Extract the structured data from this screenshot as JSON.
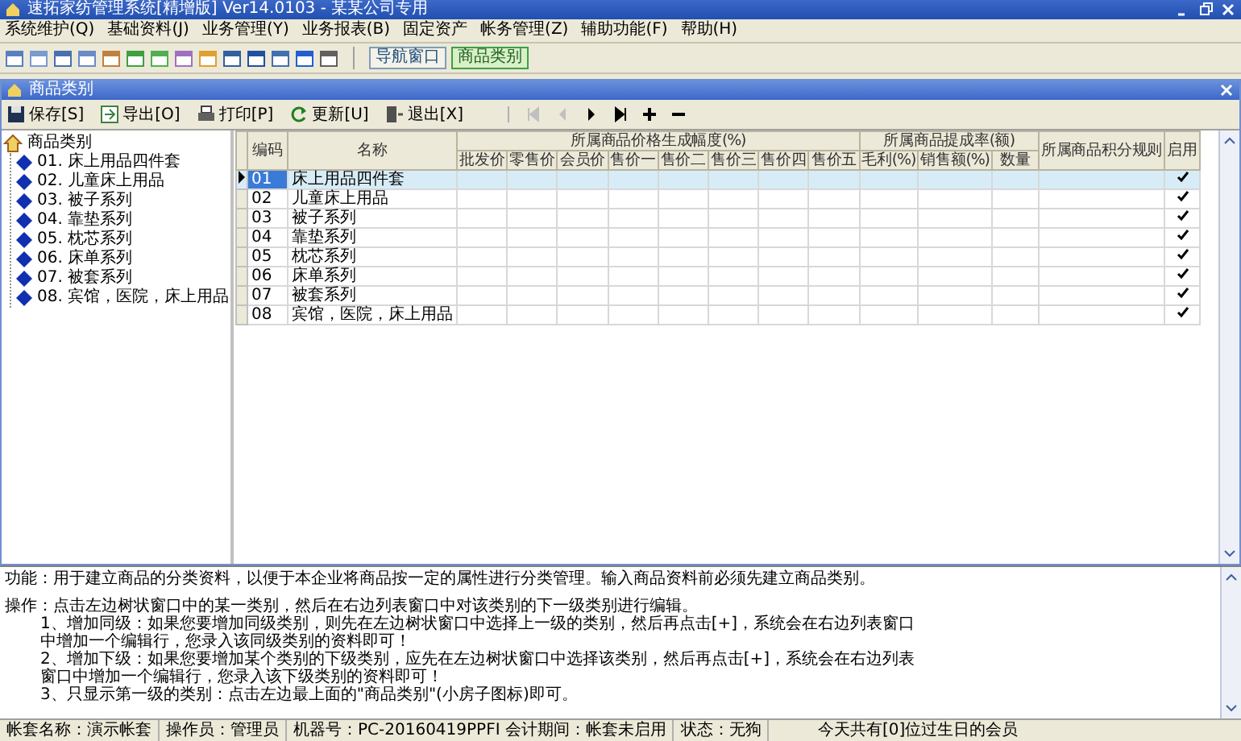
{
  "window": {
    "title": "速拓家纺管理系统[精增版] Ver14.0103 - 某某公司专用"
  },
  "menu": [
    "系统维护(Q)",
    "基础资料(J)",
    "业务管理(Y)",
    "业务报表(B)",
    "固定资产",
    "帐务管理(Z)",
    "辅助功能(F)",
    "帮助(H)"
  ],
  "toolbar": {
    "buttons": [
      {
        "label": "导航窗口",
        "selected": false
      },
      {
        "label": "商品类别",
        "selected": true
      }
    ]
  },
  "child_window": {
    "title": "商品类别"
  },
  "child_toolbar": {
    "buttons": [
      {
        "label": "保存[S]",
        "kind": "save"
      },
      {
        "label": "导出[O]",
        "kind": "export"
      },
      {
        "label": "打印[P]",
        "kind": "print"
      },
      {
        "label": "更新[U]",
        "kind": "refresh"
      },
      {
        "label": "退出[X]",
        "kind": "exit"
      }
    ],
    "nav": [
      {
        "kind": "first",
        "disabled": true
      },
      {
        "kind": "prev",
        "disabled": true
      },
      {
        "kind": "next",
        "disabled": false
      },
      {
        "kind": "last",
        "disabled": false
      },
      {
        "kind": "add",
        "disabled": false
      },
      {
        "kind": "remove",
        "disabled": false
      }
    ]
  },
  "tree": {
    "root": "商品类别",
    "children": [
      {
        "label": "01. 床上用品四件套"
      },
      {
        "label": "02. 儿童床上用品"
      },
      {
        "label": "03. 被子系列"
      },
      {
        "label": "04. 靠垫系列"
      },
      {
        "label": "05. 枕芯系列"
      },
      {
        "label": "06. 床单系列"
      },
      {
        "label": "07. 被套系列"
      },
      {
        "label": "08. 宾馆，医院，床上用品"
      }
    ]
  },
  "grid": {
    "columns": [
      "编码",
      "名称"
    ],
    "groups": [
      {
        "label": "所属商品价格生成幅度(%)",
        "columns": [
          "批发价",
          "零售价",
          "会员价",
          "售价一",
          "售价二",
          "售价三",
          "售价四",
          "售价五"
        ]
      },
      {
        "label": "所属商品提成率(额)",
        "columns": [
          "毛利(%)",
          "销售额(%)",
          "数量"
        ]
      }
    ],
    "tail_columns": [
      "所属商品积分规则",
      "启用"
    ],
    "rows": [
      {
        "code": "01",
        "name": "床上用品四件套",
        "selected": true,
        "enabled": true
      },
      {
        "code": "02",
        "name": "儿童床上用品",
        "selected": false,
        "enabled": true
      },
      {
        "code": "03",
        "name": "被子系列",
        "selected": false,
        "enabled": true
      },
      {
        "code": "04",
        "name": "靠垫系列",
        "selected": false,
        "enabled": true
      },
      {
        "code": "05",
        "name": "枕芯系列",
        "selected": false,
        "enabled": true
      },
      {
        "code": "06",
        "name": "床单系列",
        "selected": false,
        "enabled": true
      },
      {
        "code": "07",
        "name": "被套系列",
        "selected": false,
        "enabled": true
      },
      {
        "code": "08",
        "name": "宾馆，医院，床上用品",
        "selected": false,
        "enabled": true
      }
    ]
  },
  "help": {
    "lines": [
      {
        "text": "功能：用于建立商品的分类资料，以便于本企业将商品按一定的属性进行分类管理。输入商品资料前必须先建立商品类别。",
        "indent": false
      },
      {
        "text": "操作：点击左边树状窗口中的某一类别，然后在右边列表窗口中对该类别的下一级类别进行编辑。",
        "indent": false
      },
      {
        "text": "1、增加同级：如果您要增加同级类别，则先在左边树状窗口中选择上一级的类别，然后再点击[+]，系统会在右边列表窗口中增加一个编辑行，您录入该同级类别的资料即可！",
        "indent": true
      },
      {
        "text": "2、增加下级：如果您要增加某个类别的下级类别，应先在左边树状窗口中选择该类别，然后再点击[+]，系统会在右边列表窗口中增加一个编辑行，您录入该下级类别的资料即可！",
        "indent": true
      },
      {
        "text": "3、只显示第一级的类别：点击左边最上面的\"商品类别\"(小房子图标)即可。",
        "indent": true
      }
    ]
  },
  "status_bar": [
    "帐套名称：演示帐套",
    "操作员：管理员",
    "机器号：PC-20160419PPFI 会计期间：帐套未启用",
    "状态：无狗",
    "今天共有[0]位过生日的会员"
  ]
}
